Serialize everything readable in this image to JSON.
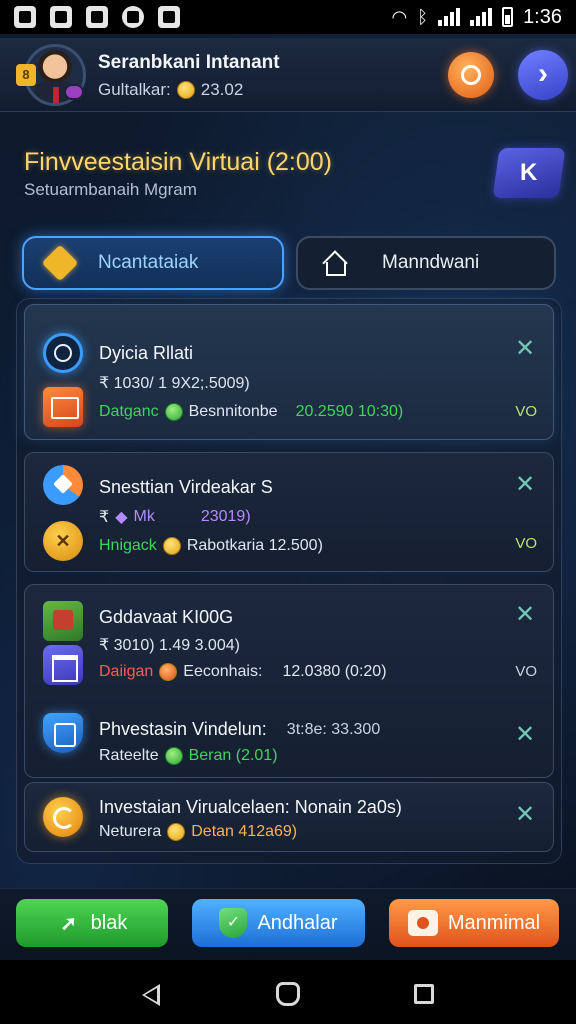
{
  "status_bar": {
    "time": "1:36",
    "icons": [
      "app-icon-1",
      "app-icon-2",
      "app-icon-3",
      "app-icon-4",
      "app-icon-5",
      "wifi-icon",
      "bluetooth-icon",
      "signal-icon",
      "battery-icon"
    ]
  },
  "header": {
    "name": "Seranbkani Intanant",
    "subtitle_label": "Gultalkar:",
    "subtitle_value": "23.02"
  },
  "section": {
    "title": "Finvveestaisin Virtuai (2:00)",
    "subtitle": "Setuarmbanaih Mgram",
    "k_button_label": "K"
  },
  "tabs": [
    {
      "label": "Ncantataiak",
      "active": true
    },
    {
      "label": "Manndwani",
      "active": false
    }
  ],
  "items": [
    {
      "title": "Dyicia Rllati",
      "line1": "₹ 1030/ 1 9X2;.5009)",
      "line2_green_label": "Datganc",
      "line2_text": "Besnnitonbe",
      "line2_value": "20.2590 10:30)",
      "tag": "VO"
    },
    {
      "title": "Snesttian Virdeakar S",
      "line1_prefix": "₹",
      "line1_mid": "Mk",
      "line1_value": "23019)",
      "line2_green_label": "Hnigack",
      "line2_text": "Rabotkaria 12.500)",
      "tag": "VO"
    },
    {
      "title": "Gddavaat KI00G",
      "line1": "₹ 3010) 1.49 3.004)",
      "line2_red_label": "Daiigan",
      "line2_text": "Eeconhais:",
      "line2_value": "12.0380 (0:20)",
      "tag": "VO"
    },
    {
      "title": "Phvestasin Vindelun:",
      "title_value": "3t:8e: 33.300",
      "line1_label": "Rateelte",
      "line1_green": "Beran (2.01)"
    },
    {
      "title": "Investaian Virualcelaen: Nonain 2a0s)",
      "line1_label": "Neturera",
      "line1_orange": "Detan 412a69)"
    }
  ],
  "actions": [
    {
      "label": "blak"
    },
    {
      "label": "Andhalar"
    },
    {
      "label": "Manmimal"
    }
  ],
  "colors": {
    "background": "#0b1626",
    "accent_blue": "#4aa3ff",
    "title_gold": "#ffd66a",
    "positive_green": "#3fd65a"
  }
}
